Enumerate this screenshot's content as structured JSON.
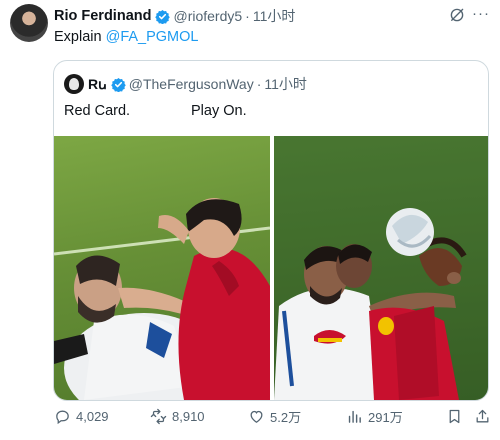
{
  "tweet": {
    "author_name": "Rio Ferdinand",
    "author_handle": "@rioferdy5",
    "separator": "·",
    "time": "11小时",
    "text_prefix": "Explain ",
    "mention": "@FA_PGMOL"
  },
  "quote": {
    "author_name": "Rꭎ",
    "author_handle": "@TheFergusonWay",
    "separator": "·",
    "time": "11小时",
    "text_left": "Red Card.",
    "text_right": "Play On."
  },
  "actions": {
    "replies": "4,029",
    "retweets": "8,910",
    "likes": "5.2万",
    "views": "291万"
  },
  "colors": {
    "verified": "#1d9bf0",
    "link": "#1d9bf0",
    "muted": "#536471"
  }
}
